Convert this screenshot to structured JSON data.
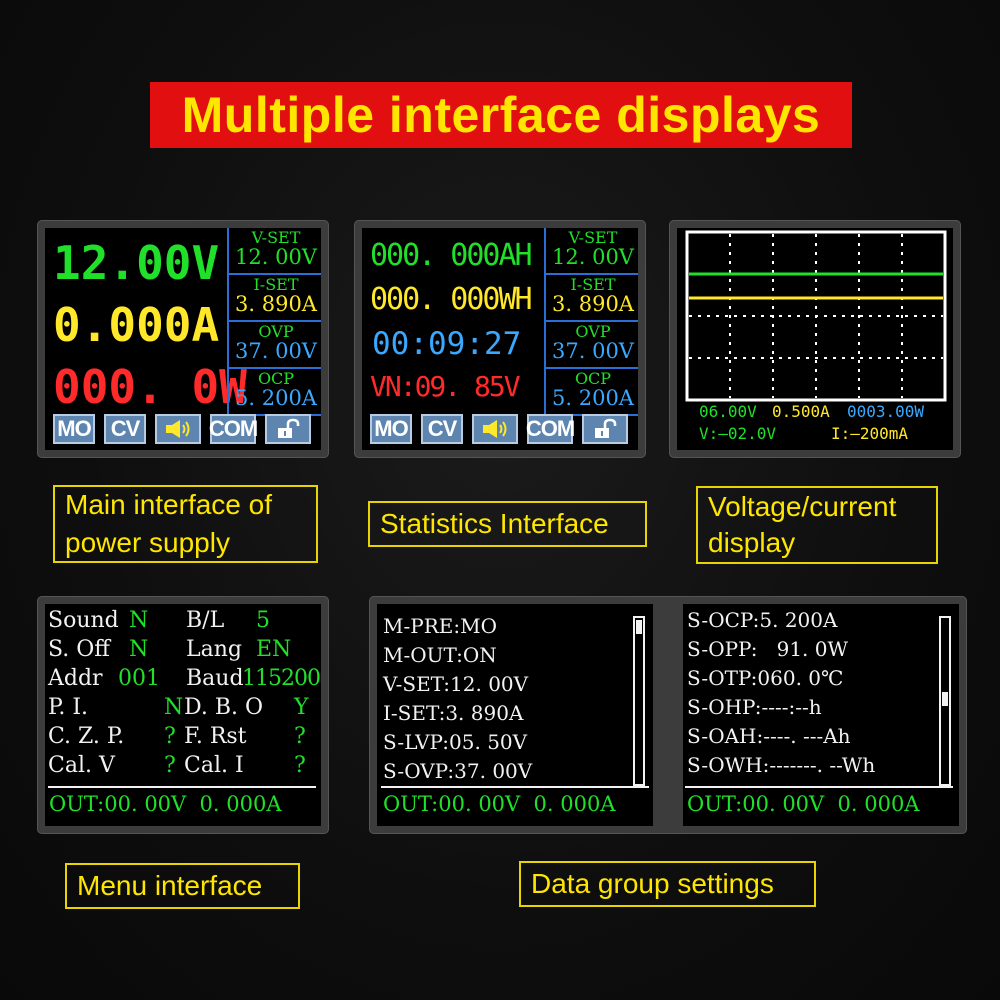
{
  "title": "Multiple interface displays",
  "colors": {
    "banner_bg": "#e10f0f",
    "banner_text": "#ffe600",
    "green": "#21e02a",
    "yellow": "#ffe82a",
    "red": "#ff2a2a",
    "blue": "#3aa8ff",
    "divider": "#2b6fd6"
  },
  "main": {
    "voltage": "12.00V",
    "current": "0.000A",
    "power": "000. 0W",
    "side": [
      {
        "label": "V-SET",
        "value": "12. 00V"
      },
      {
        "label": "I-SET",
        "value": "3. 890A"
      },
      {
        "label": "OVP",
        "value": "37. 00V"
      },
      {
        "label": "OCP",
        "value": "5. 200A"
      }
    ],
    "buttons": {
      "mo": "MO",
      "cv": "CV",
      "sound_icon": "speaker-icon",
      "com": "COM",
      "lock_icon": "lock-icon"
    },
    "caption": "Main interface of power supply"
  },
  "stats": {
    "ah": "000. 000AH",
    "wh": "000. 000WH",
    "time": "00:09:27",
    "vn": "VN:09. 85V",
    "side": [
      {
        "label": "V-SET",
        "value": "12. 00V"
      },
      {
        "label": "I-SET",
        "value": "3. 890A"
      },
      {
        "label": "OVP",
        "value": "37. 00V"
      },
      {
        "label": "OCP",
        "value": "5. 200A"
      }
    ],
    "buttons": {
      "mo": "MO",
      "cv": "CV",
      "sound_icon": "speaker-icon",
      "com": "COM",
      "lock_icon": "lock-icon"
    },
    "caption": "Statistics Interface"
  },
  "graph": {
    "readout_v": "06.00V",
    "readout_a": "0.500A",
    "readout_w": "0003.00W",
    "scale_v": "V:—02.0V",
    "scale_i": "I:—200mA",
    "caption": "Voltage/current display"
  },
  "menu": {
    "rows": [
      {
        "l1": "Sound",
        "v1": "N",
        "l2": "B/L",
        "v2": "5"
      },
      {
        "l1": "S. Off",
        "v1": "N",
        "l2": "Lang",
        "v2": "EN"
      },
      {
        "l1": "Addr",
        "v1": "001",
        "l2": "Baud",
        "v2": "115200"
      },
      {
        "l1": "P. I.",
        "v1": "N",
        "l2": "D. B. O",
        "v2": "Y"
      },
      {
        "l1": "C. Z. P.",
        "v1": "?",
        "l2": "F. Rst",
        "v2": "?"
      },
      {
        "l1": "Cal. V",
        "v1": "?",
        "l2": "Cal. I",
        "v2": "?"
      }
    ],
    "out": "OUT:00. 00V  0. 000A",
    "caption": "Menu interface"
  },
  "datagroup": {
    "left": [
      "M-PRE:MO",
      "M-OUT:ON",
      "V-SET:12. 00V",
      "I-SET:3. 890A",
      "S-LVP:05. 50V",
      "S-OVP:37. 00V"
    ],
    "right": [
      "S-OCP:5. 200A",
      "S-OPP:   91. 0W",
      "S-OTP:060. 0℃",
      "S-OHP:----:--h",
      "S-OAH:----. ---Ah",
      "S-OWH:-------. --Wh"
    ],
    "out_left": "OUT:00. 00V  0. 000A",
    "out_right": "OUT:00. 00V  0. 000A",
    "caption": "Data group settings"
  }
}
